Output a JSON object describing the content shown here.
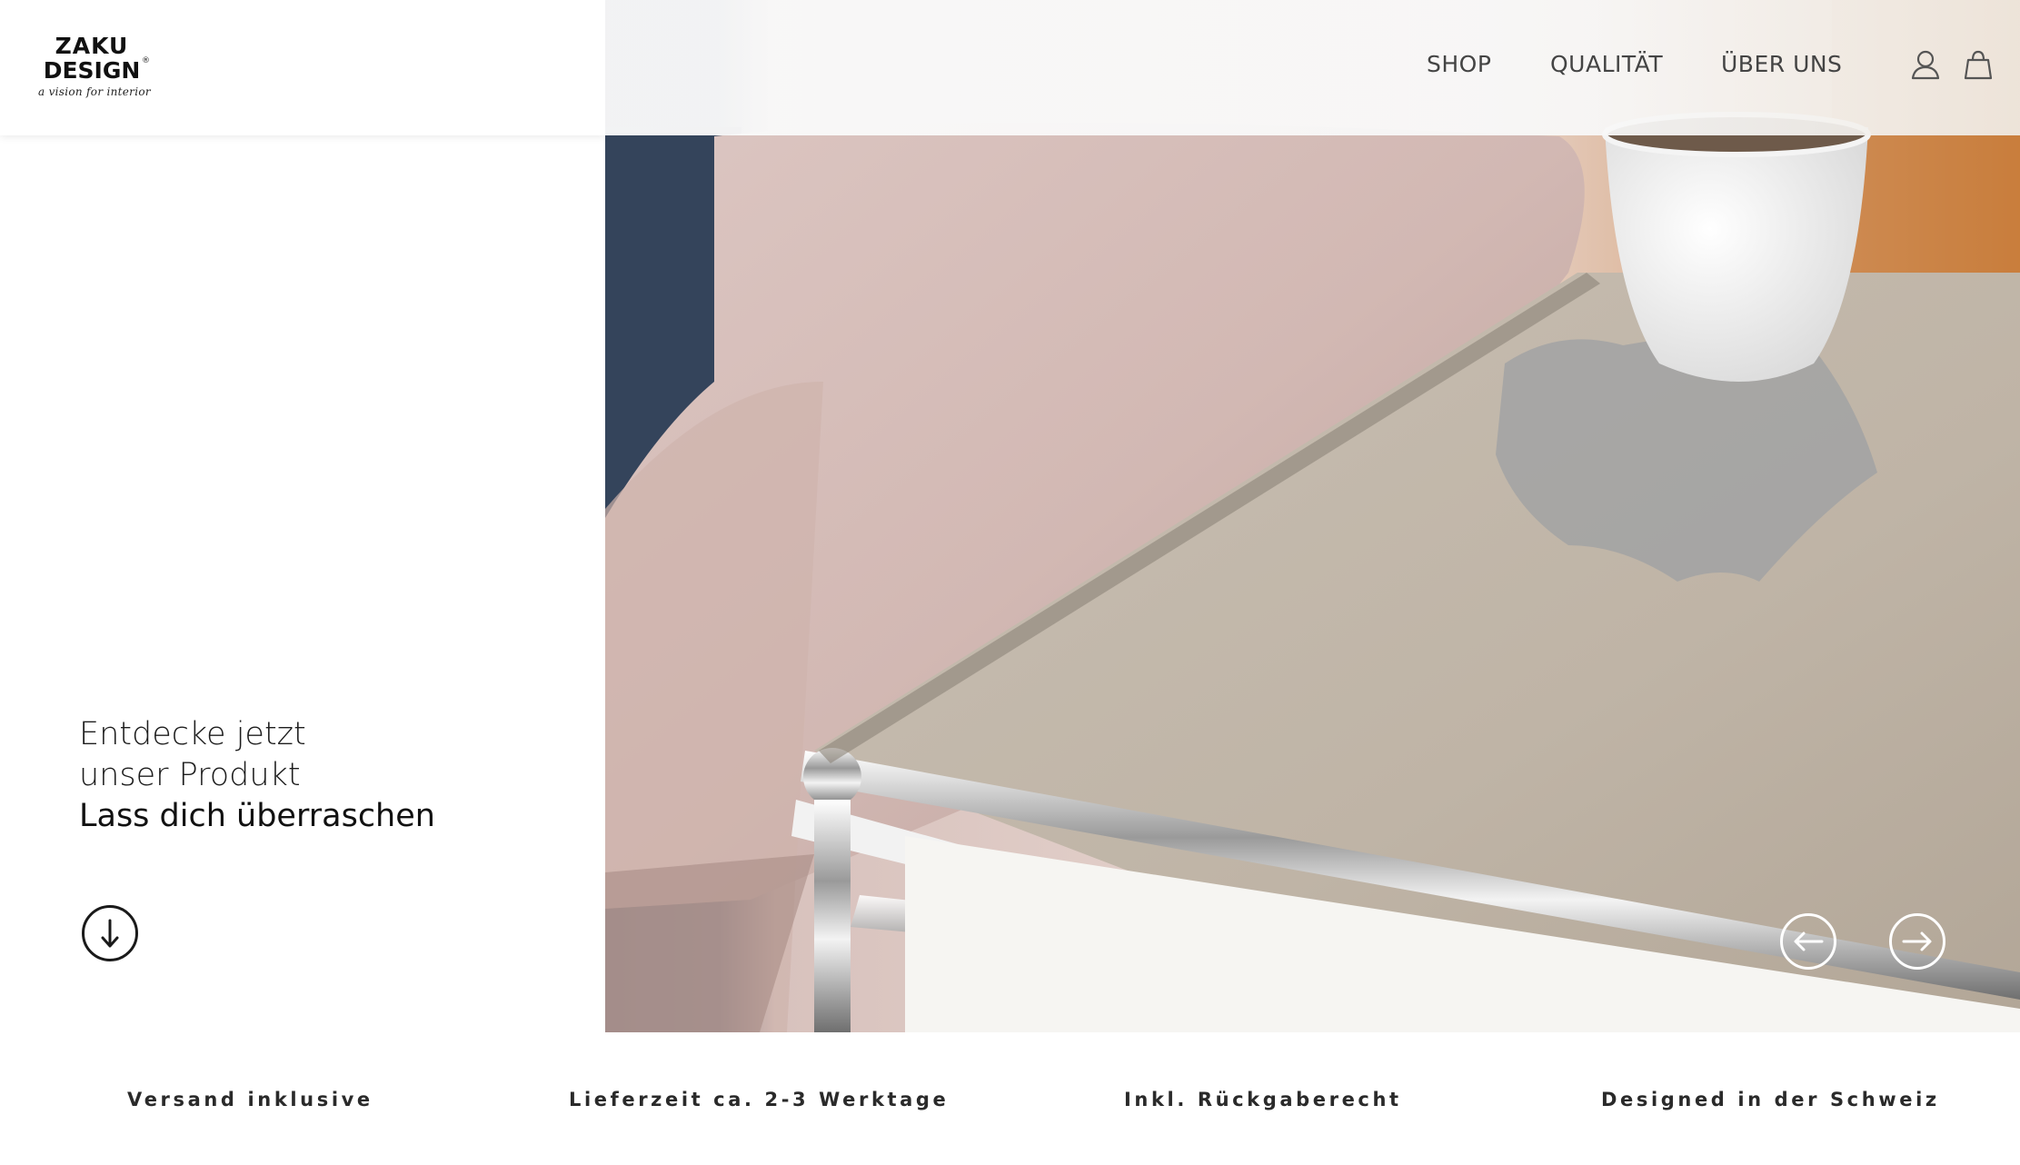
{
  "brand": {
    "line1": "ZAKU",
    "line2": "DESIGN",
    "registered": "®",
    "tagline": "a vision for interior"
  },
  "nav": {
    "items": [
      {
        "label": "SHOP"
      },
      {
        "label": "QUALITÄT"
      },
      {
        "label": "ÜBER UNS"
      }
    ],
    "icons": [
      "user-icon",
      "shopping-bag-icon"
    ]
  },
  "hero": {
    "line1": "Entdecke jetzt",
    "line2": "unser Produkt",
    "line3": "Lass dich überraschen",
    "prev_icon": "arrow-left-icon",
    "next_icon": "arrow-right-icon",
    "scroll_icon": "arrow-down-icon"
  },
  "features": [
    {
      "label": "Versand inklusive"
    },
    {
      "label": "Lieferzeit ca. 2-3 Werktage"
    },
    {
      "label": "Inkl. Rückgaberecht"
    },
    {
      "label": "Designed in der Schweiz"
    }
  ],
  "colors": {
    "text": "#1a1a1a",
    "nav_text": "#444444",
    "leather_top": "#bdb3a6",
    "sofa": "#d9c3c0",
    "chrome": "#e6e6e6"
  }
}
